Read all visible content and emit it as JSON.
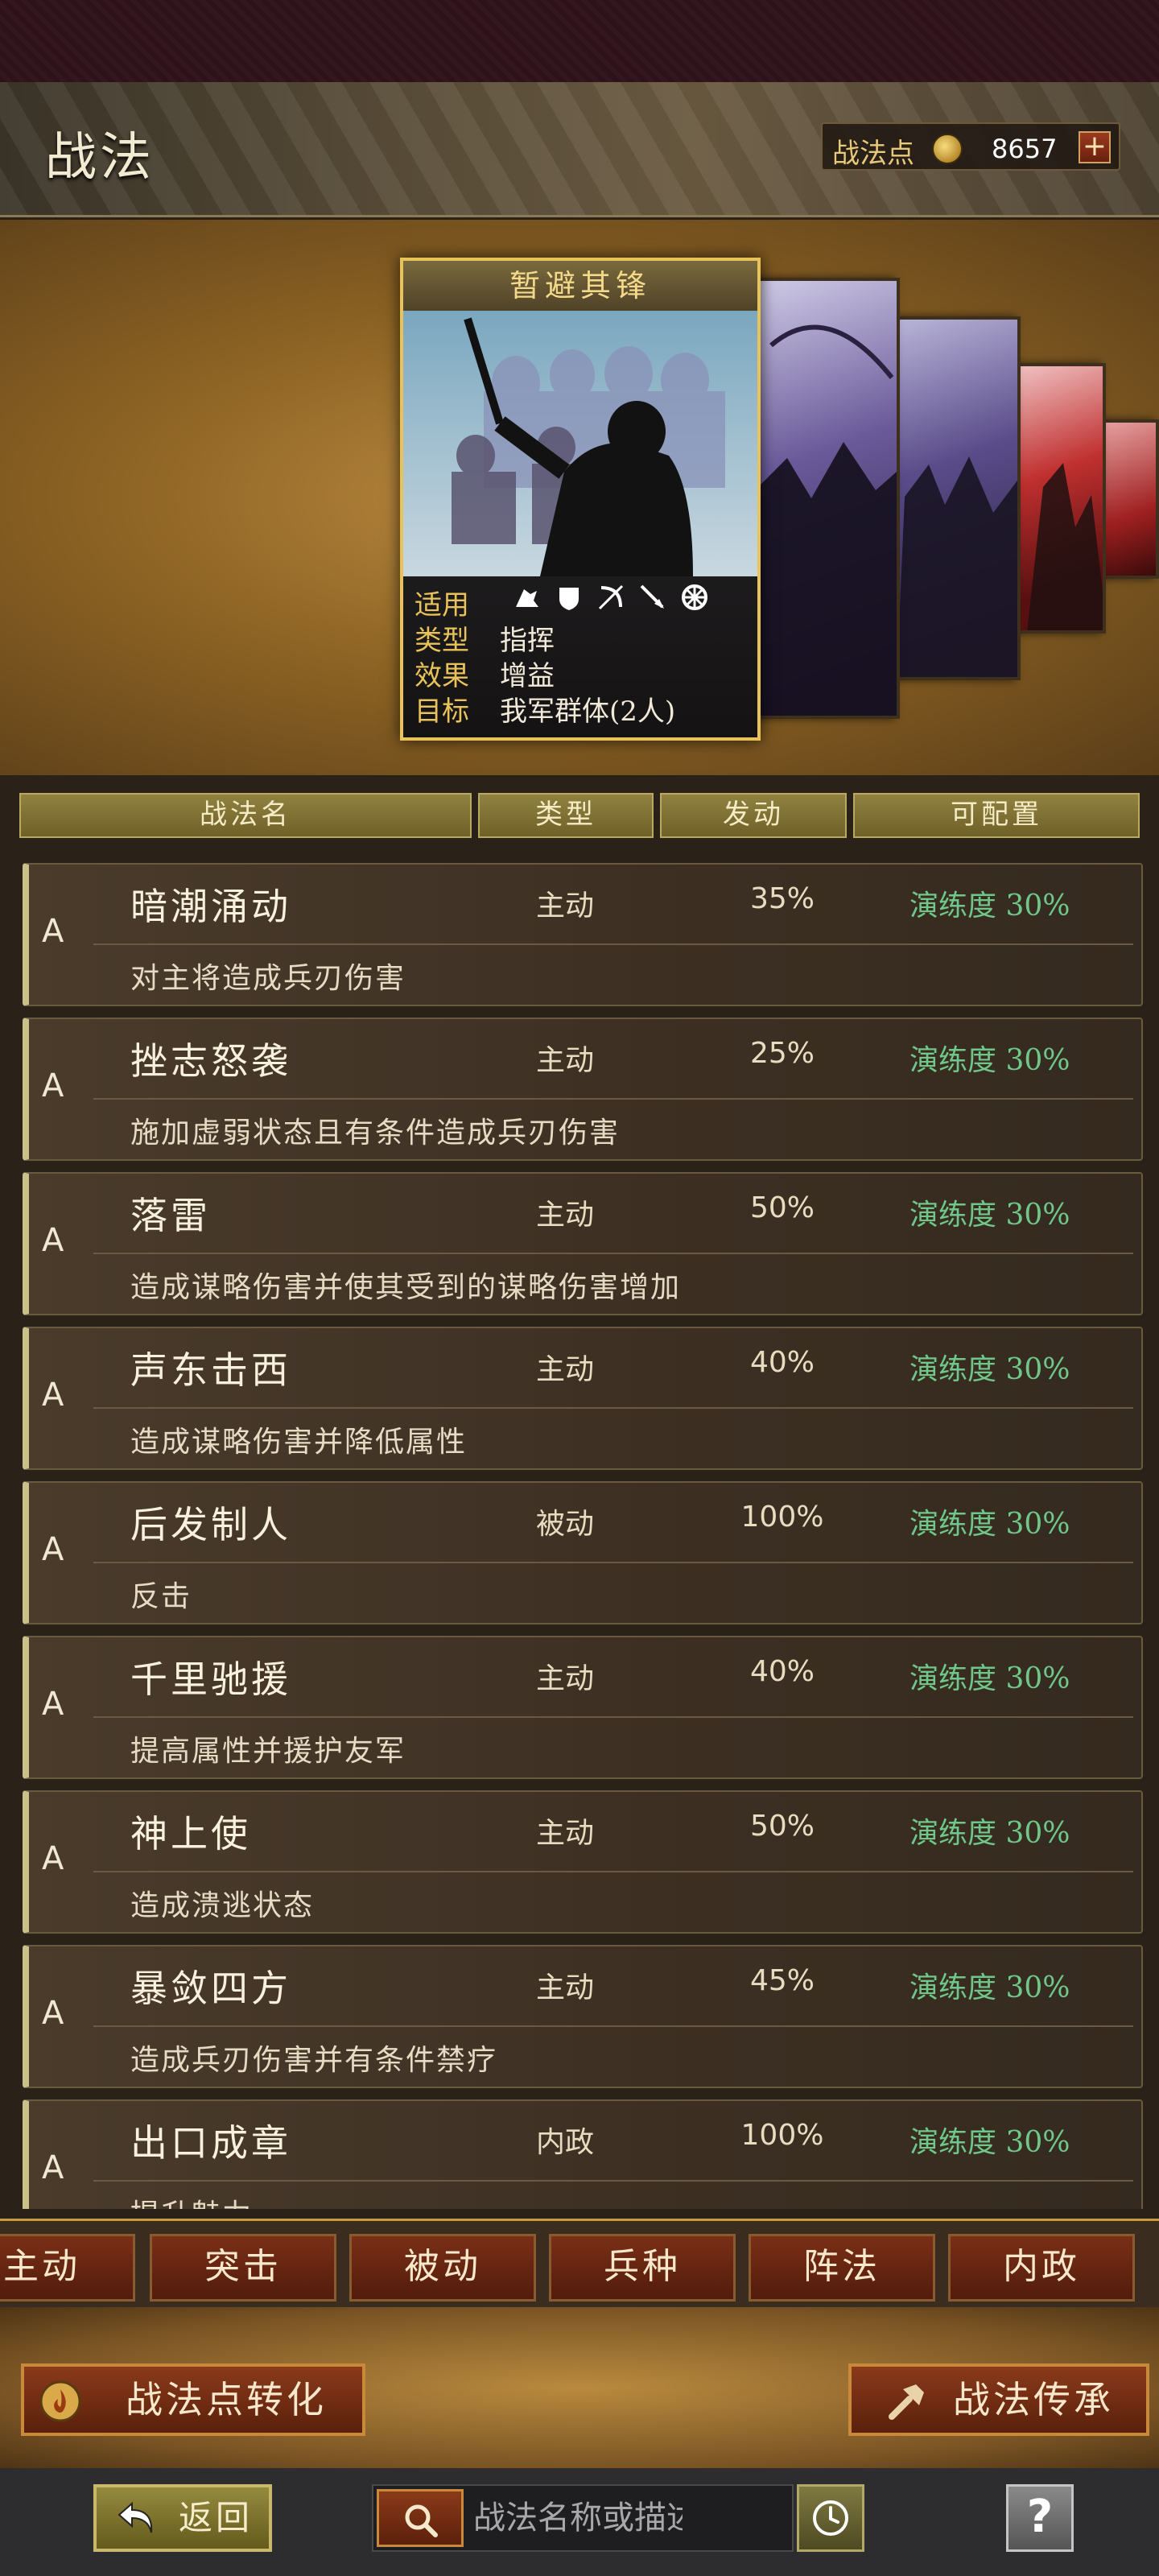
{
  "header": {
    "title": "战法",
    "points_label": "战法点",
    "points_value": "8657",
    "plus_symbol": "+"
  },
  "featured_card": {
    "name": "暂避其锋",
    "info": [
      {
        "key": "适用",
        "value": ""
      },
      {
        "key": "类型",
        "value": "指挥"
      },
      {
        "key": "效果",
        "value": "增益"
      },
      {
        "key": "目标",
        "value": "我军群体(2人)"
      }
    ],
    "unit_icons": [
      "cavalry-icon",
      "shield-icon",
      "bow-icon",
      "spear-icon",
      "wheel-icon"
    ]
  },
  "table_headers": [
    "战法名",
    "类型",
    "发动",
    "可配置"
  ],
  "tactics": [
    {
      "grade": "A",
      "name": "暗潮涌动",
      "type": "主动",
      "rate": "35%",
      "proficiency": "演练度 30%",
      "desc": "对主将造成兵刃伤害"
    },
    {
      "grade": "A",
      "name": "挫志怒袭",
      "type": "主动",
      "rate": "25%",
      "proficiency": "演练度 30%",
      "desc": "施加虚弱状态且有条件造成兵刃伤害"
    },
    {
      "grade": "A",
      "name": "落雷",
      "type": "主动",
      "rate": "50%",
      "proficiency": "演练度 30%",
      "desc": "造成谋略伤害并使其受到的谋略伤害增加"
    },
    {
      "grade": "A",
      "name": "声东击西",
      "type": "主动",
      "rate": "40%",
      "proficiency": "演练度 30%",
      "desc": "造成谋略伤害并降低属性"
    },
    {
      "grade": "A",
      "name": "后发制人",
      "type": "被动",
      "rate": "100%",
      "proficiency": "演练度 30%",
      "desc": "反击"
    },
    {
      "grade": "A",
      "name": "千里驰援",
      "type": "主动",
      "rate": "40%",
      "proficiency": "演练度 30%",
      "desc": "提高属性并援护友军"
    },
    {
      "grade": "A",
      "name": "神上使",
      "type": "主动",
      "rate": "50%",
      "proficiency": "演练度 30%",
      "desc": "造成溃逃状态"
    },
    {
      "grade": "A",
      "name": "暴敛四方",
      "type": "主动",
      "rate": "45%",
      "proficiency": "演练度 30%",
      "desc": "造成兵刃伤害并有条件禁疗"
    },
    {
      "grade": "A",
      "name": "出口成章",
      "type": "内政",
      "rate": "100%",
      "proficiency": "演练度 30%",
      "desc": "提升魅力"
    }
  ],
  "filter_tabs": [
    "主动",
    "突击",
    "被动",
    "兵种",
    "阵法",
    "内政"
  ],
  "actions": {
    "convert_label": "战法点转化",
    "inherit_label": "战法传承"
  },
  "toolbar": {
    "back_label": "返回",
    "search_placeholder": "战法名称或描述",
    "help_symbol": "?"
  }
}
